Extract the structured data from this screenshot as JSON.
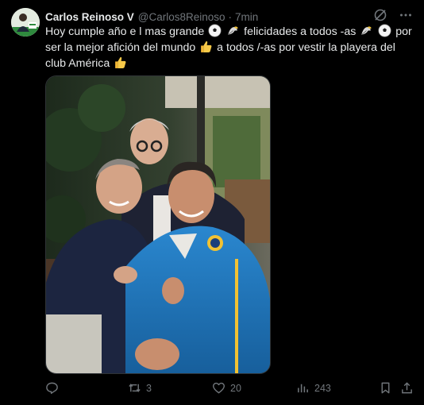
{
  "post": {
    "author_name": "Carlos Reinoso V",
    "handle": "@Carlos8Reinoso",
    "separator": "·",
    "time": "7min",
    "text": {
      "part1": "Hoy cumple año e l mas grande",
      "part2": "felicidades a todos -as",
      "part3": "por ser la mejor afición del mundo",
      "part4": "a todos /-as por vestir la playera del club América"
    },
    "icons": {
      "grok": "grok-icon",
      "more": "more-icon",
      "reply": "reply-icon",
      "repost": "repost-icon",
      "like": "like-icon",
      "views": "views-icon",
      "bookmark": "bookmark-icon",
      "share": "share-icon"
    },
    "stats": {
      "reposts": "3",
      "likes": "20",
      "views": "243"
    }
  },
  "colors": {
    "background": "#000000",
    "text": "#e7e9ea",
    "muted": "#71767b",
    "club_blue": "#1f7cc1"
  }
}
